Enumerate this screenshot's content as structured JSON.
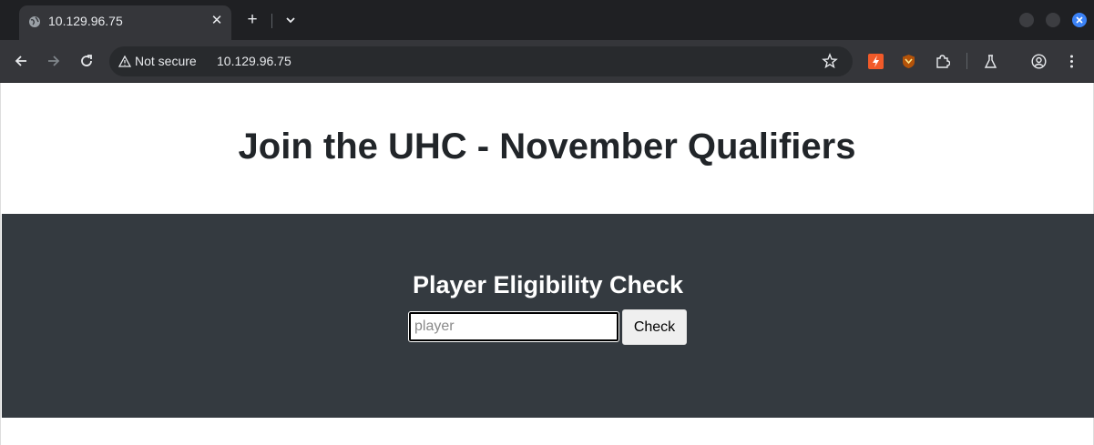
{
  "browser": {
    "tab": {
      "title": "10.129.96.75"
    },
    "omnibox": {
      "security_label": "Not secure",
      "url": "10.129.96.75"
    }
  },
  "page": {
    "header_title": "Join the UHC - November Qualifiers",
    "eligibility": {
      "title": "Player Eligibility Check",
      "input_placeholder": "player",
      "input_value": "",
      "button_label": "Check"
    }
  },
  "colors": {
    "chrome_dark": "#1f2023",
    "toolbar": "#35363a",
    "band": "#343a40",
    "heading_text": "#212529"
  }
}
